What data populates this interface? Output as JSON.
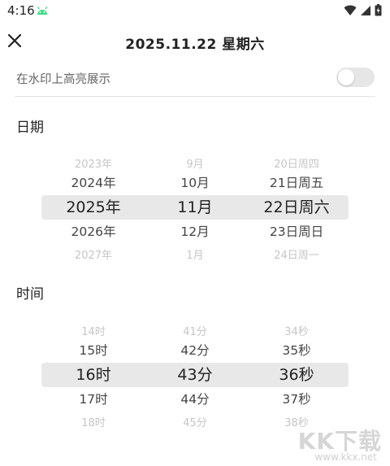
{
  "status_bar": {
    "time": "4:16"
  },
  "header": {
    "title": "2025.11.22 星期六"
  },
  "highlight_toggle": {
    "label": "在水印上高亮展示",
    "on": false
  },
  "date_section": {
    "title": "日期",
    "year_col": [
      "2023年",
      "2024年",
      "2025年",
      "2026年",
      "2027年"
    ],
    "month_col": [
      "9月",
      "10月",
      "11月",
      "12月",
      "1月"
    ],
    "day_col": [
      "20日周四",
      "21日周五",
      "22日周六",
      "23日周日",
      "24日周一"
    ]
  },
  "time_section": {
    "title": "时间",
    "hour_col": [
      "14时",
      "15时",
      "16时",
      "17时",
      "18时"
    ],
    "minute_col": [
      "41分",
      "42分",
      "43分",
      "44分",
      "45分"
    ],
    "second_col": [
      "34秒",
      "35秒",
      "36秒",
      "37秒",
      "38秒"
    ]
  },
  "watermark": {
    "text": "KK下载",
    "url": "www.kkx.net"
  },
  "colors": {
    "highlight_band": "#e8e8e8",
    "toggle_off": "#e6e6e6",
    "text": "#222222",
    "faded": "#c6c6c6"
  }
}
